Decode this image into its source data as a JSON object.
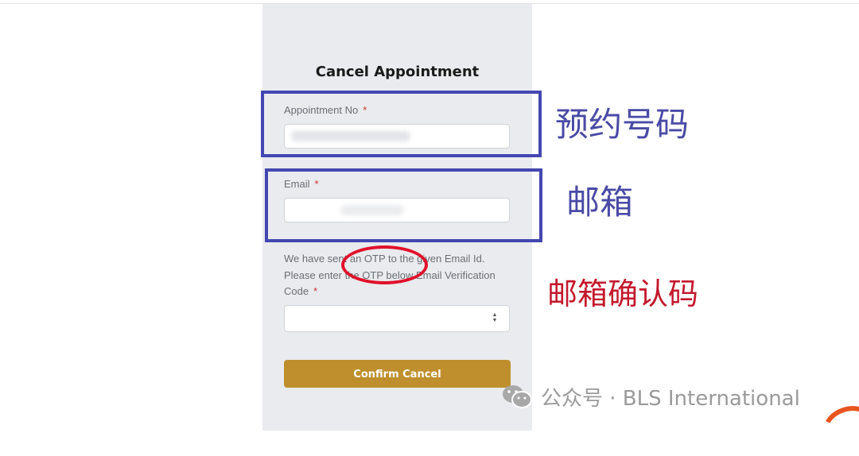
{
  "form": {
    "title": "Cancel Appointment",
    "appointment_label": "Appointment No",
    "email_label": "Email",
    "required_mark": "*",
    "helper_line1": "We have sent an OTP to the given Email Id.",
    "helper_line2": "Please enter the OTP below Email Verification",
    "otp_label": "Code",
    "confirm_button": "Confirm Cancel"
  },
  "annotations": {
    "appointment": "预约号码",
    "email": "邮箱",
    "otp": "邮箱确认码"
  },
  "watermark": {
    "text": "公众号 · BLS International",
    "icon": "wechat-icon"
  },
  "colors": {
    "panel_bg": "#e9ebee",
    "button": "#bf8f2d",
    "annotation_box": "#4447b0",
    "annotation_circle": "#e0112a",
    "annotation_red_text": "#c4182c"
  }
}
